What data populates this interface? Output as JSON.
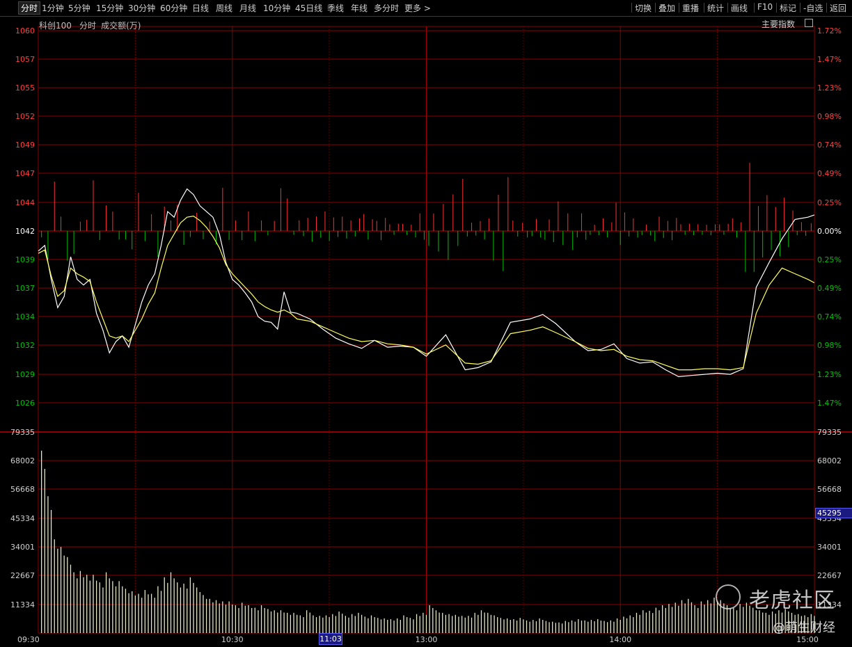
{
  "toolbar": {
    "tabs": [
      "分时",
      "1分钟",
      "5分钟",
      "15分钟",
      "30分钟",
      "60分钟",
      "日线",
      "周线",
      "月线",
      "10分钟",
      "45日线",
      "季线",
      "年线",
      "多分时",
      "更多 >"
    ],
    "actions": [
      "切换",
      "叠加",
      "重播",
      "统计",
      "画线",
      "F10",
      "标记",
      "-自选",
      "返回"
    ]
  },
  "header": {
    "index_name": "科创100",
    "mode": "分时",
    "metric": "成交额(万)",
    "main_index_label": "主要指数"
  },
  "selected_time": "11:03",
  "selected_volume": "45295",
  "watermark": {
    "brand": "老虎社区",
    "author": "@萌生财经"
  },
  "colors": {
    "up": "#ff3030",
    "down": "#00c000",
    "grid": "#8b0000",
    "price": "#ffffff",
    "avg": "#ffff60"
  },
  "chart_data": [
    {
      "type": "line",
      "title": "",
      "y_left_ticks": [
        "1060",
        "1057",
        "1055",
        "1052",
        "1049",
        "1047",
        "1044",
        "1042",
        "1039",
        "1037",
        "1034",
        "1032",
        "1029",
        "1026"
      ],
      "y_right_ticks": [
        "1.72%",
        "1.47%",
        "1.23%",
        "0.98%",
        "0.74%",
        "0.49%",
        "0.25%",
        "0.00%",
        "0.25%",
        "0.49%",
        "0.74%",
        "0.98%",
        "1.23%",
        "1.47%"
      ],
      "ylim": [
        1024.5,
        1060
      ],
      "previous_close": 1042,
      "x_ticks": [
        "09:30",
        "10:30",
        "11:03",
        "13:00",
        "14:00",
        "15:00"
      ],
      "series": [
        {
          "name": "price",
          "x": [
            0,
            2,
            4,
            6,
            8,
            10,
            12,
            14,
            16,
            18,
            20,
            22,
            24,
            26,
            28,
            30,
            32,
            34,
            36,
            38,
            40,
            42,
            44,
            46,
            48,
            50,
            52,
            54,
            56,
            58,
            60,
            62,
            64,
            66,
            68,
            70,
            72,
            74,
            76,
            78,
            80,
            84,
            88,
            92,
            96,
            100,
            104,
            108,
            112,
            116,
            120,
            126,
            132,
            136,
            140,
            146,
            152,
            156,
            160,
            166,
            170,
            174,
            178,
            182,
            186,
            190,
            194,
            198,
            202,
            206,
            210,
            214,
            218,
            222,
            226,
            230,
            234,
            238,
            240
          ],
          "values": [
            1040.5,
            1041.0,
            1038.0,
            1035.5,
            1036.5,
            1040.0,
            1038.0,
            1037.5,
            1038.0,
            1035.0,
            1033.5,
            1031.5,
            1032.5,
            1033.0,
            1032.0,
            1034.0,
            1036.0,
            1037.5,
            1038.5,
            1041.0,
            1044.0,
            1043.5,
            1045.0,
            1046.0,
            1045.5,
            1044.5,
            1044.0,
            1043.5,
            1042.0,
            1039.5,
            1038.0,
            1037.5,
            1036.8,
            1036.0,
            1034.7,
            1034.3,
            1034.2,
            1033.6,
            1036.9,
            1035.1,
            1035.0,
            1034.5,
            1033.6,
            1032.8,
            1032.3,
            1031.9,
            1032.6,
            1032.0,
            1032.1,
            1032.0,
            1031.2,
            1033.1,
            1030.0,
            1030.2,
            1030.7,
            1034.2,
            1034.5,
            1034.9,
            1034.1,
            1032.5,
            1031.7,
            1031.8,
            1032.3,
            1031.0,
            1030.6,
            1030.7,
            1030.0,
            1029.4,
            1029.5,
            1029.6,
            1029.7,
            1029.6,
            1030.1,
            1037.3,
            1039.5,
            1041.6,
            1043.3,
            1043.5,
            1043.7
          ]
        },
        {
          "name": "average",
          "x": [
            0,
            2,
            4,
            6,
            8,
            10,
            12,
            14,
            16,
            18,
            20,
            22,
            24,
            26,
            28,
            30,
            32,
            34,
            36,
            38,
            40,
            42,
            44,
            46,
            48,
            50,
            52,
            54,
            56,
            58,
            60,
            62,
            64,
            66,
            68,
            70,
            72,
            74,
            76,
            78,
            80,
            84,
            88,
            92,
            96,
            100,
            104,
            108,
            112,
            116,
            120,
            126,
            132,
            136,
            140,
            146,
            152,
            156,
            160,
            166,
            170,
            174,
            178,
            182,
            186,
            190,
            194,
            198,
            202,
            206,
            210,
            214,
            218,
            222,
            226,
            230,
            234,
            238,
            240
          ],
          "values": [
            1040.3,
            1040.6,
            1038.3,
            1036.5,
            1037.0,
            1039.0,
            1038.5,
            1038.2,
            1037.8,
            1036.0,
            1034.5,
            1033.0,
            1032.8,
            1033.0,
            1032.5,
            1033.5,
            1034.5,
            1035.8,
            1036.8,
            1039.0,
            1041.0,
            1042.0,
            1043.0,
            1043.5,
            1043.6,
            1043.2,
            1042.6,
            1041.8,
            1040.8,
            1039.3,
            1038.5,
            1037.9,
            1037.3,
            1036.7,
            1036.0,
            1035.6,
            1035.3,
            1035.1,
            1035.3,
            1035.0,
            1034.5,
            1034.3,
            1033.8,
            1033.3,
            1032.8,
            1032.5,
            1032.6,
            1032.3,
            1032.2,
            1032.0,
            1031.4,
            1032.2,
            1030.6,
            1030.5,
            1030.8,
            1033.2,
            1033.5,
            1033.8,
            1033.3,
            1032.5,
            1031.9,
            1031.7,
            1031.8,
            1031.2,
            1030.9,
            1030.8,
            1030.4,
            1030.0,
            1030.0,
            1030.1,
            1030.1,
            1030.0,
            1030.2,
            1035.0,
            1037.5,
            1039.0,
            1038.5,
            1038.0,
            1037.7
          ]
        }
      ]
    },
    {
      "type": "bar",
      "title": "",
      "y_left_ticks": [
        "79335",
        "68002",
        "56668",
        "45334",
        "34001",
        "22667",
        "11334"
      ],
      "ylim": [
        0,
        79335
      ],
      "minutes": [
        1,
        3,
        5,
        7,
        9,
        11,
        13,
        15,
        17,
        19,
        21,
        23,
        25,
        27,
        29,
        31,
        33,
        35,
        37,
        39,
        41,
        43,
        45,
        47,
        49,
        51,
        53,
        55,
        57,
        59,
        61,
        63,
        65,
        67,
        69,
        71,
        73,
        75,
        77,
        79,
        81,
        83,
        85,
        87,
        89,
        91,
        93,
        95,
        97,
        99,
        101,
        103,
        105,
        107,
        109,
        111,
        113,
        115,
        117,
        119,
        121,
        123,
        125,
        127,
        129,
        131,
        133,
        135,
        137,
        139,
        141,
        143,
        145,
        147,
        149,
        151,
        153,
        155,
        157,
        159,
        161,
        163,
        165,
        167,
        169,
        171,
        173,
        175,
        177,
        179,
        181,
        183,
        185,
        187,
        189,
        191,
        193,
        195,
        197,
        199,
        201,
        203,
        205,
        207,
        209,
        211,
        213,
        215,
        217,
        219,
        221,
        223,
        225,
        227,
        229,
        231,
        233,
        235,
        237,
        239
      ],
      "values": [
        72000,
        54000,
        37000,
        34000,
        30000,
        24000,
        24500,
        23000,
        23000,
        20000,
        24000,
        20500,
        20500,
        17500,
        16500,
        15500,
        17000,
        15500,
        18500,
        22000,
        24000,
        20000,
        19500,
        22000,
        18000,
        15000,
        13500,
        13000,
        12500,
        12500,
        11000,
        12000,
        11000,
        10000,
        11000,
        9500,
        9000,
        9000,
        8000,
        8000,
        7000,
        9000,
        7000,
        6800,
        7000,
        7500,
        8500,
        6800,
        7500,
        8000,
        6500,
        7000,
        6000,
        5800,
        5500,
        5800,
        7000,
        6000,
        7500,
        8000,
        11000,
        9000,
        8000,
        7500,
        7200,
        6800,
        6800,
        8000,
        9000,
        8000,
        7000,
        6000,
        5800,
        5500,
        6000,
        5000,
        5200,
        5800,
        4800,
        4500,
        4200,
        4800,
        5000,
        5500,
        5000,
        5200,
        5500,
        4800,
        5000,
        5800,
        6500,
        7000,
        8000,
        9000,
        8800,
        10000,
        11000,
        11500,
        12000,
        13000,
        13500,
        11000,
        12500,
        13000,
        14000,
        13000,
        11000,
        10000,
        11500,
        12000,
        10000,
        9000,
        8000,
        8500,
        9000,
        9500,
        8000,
        7500,
        7000,
        7500
      ]
    }
  ]
}
